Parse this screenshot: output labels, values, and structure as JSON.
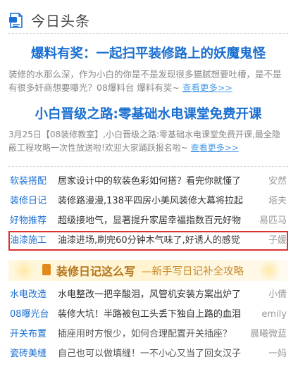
{
  "header": {
    "title": "今日头条"
  },
  "features": [
    {
      "title": "爆料有奖：一起扫平装修路上的妖魔鬼怪",
      "desc": "装修的水那么深，作为小白的你是不是发现很多猫腻想要吐槽，是不是有很多奸商想要曝光？08爆料台 爆料有奖~",
      "more": "查看更多>>"
    },
    {
      "title": "小白晋级之路:零基础水电课堂免费开课",
      "desc": "3月25日【08装修教室】,小白晋级之路:零基础水电课堂免费开课,最全隐蔽工程攻略一次性放送啦!欢迎大家踊跃报名啦~",
      "more": "查看更多>>"
    }
  ],
  "list1": [
    {
      "category": "软装搭配",
      "title": "居家设计中的软装色彩如何搭？看完你就懂了",
      "author": "安然"
    },
    {
      "category": "装修日记",
      "title": "装修路漫漫,138平四房小美风装修大幕将拉起",
      "author": "塔夫"
    },
    {
      "category": "好物推荐",
      "title": "超级接地气，显著提升家居幸福指数百元好物",
      "author": "易匹马"
    },
    {
      "category": "油漆施工",
      "title": "油漆进场,刷完60分钟木气味了,好诱人的感觉",
      "author": "子媛"
    }
  ],
  "banner": {
    "text": "装修日记这么写",
    "subtext": "—新手写日记补全攻略"
  },
  "list2": [
    {
      "category": "水电改造",
      "title": "水电整改一把辛酸泪，风管机安装方案出炉了",
      "author": "小倩"
    },
    {
      "category": "08曝光台",
      "title": "装修大坑！半路被包工头丢下独自上路的血泪",
      "author": "emily"
    },
    {
      "category": "开关布置",
      "title": "插座用时方恨少，如何合理配置开关插座？",
      "author": "晨曦微蓝"
    },
    {
      "category": "瓷砖美缝",
      "title": "自己也可以做填缝！一不小心又当了回女汉子",
      "author": "一妈"
    }
  ]
}
